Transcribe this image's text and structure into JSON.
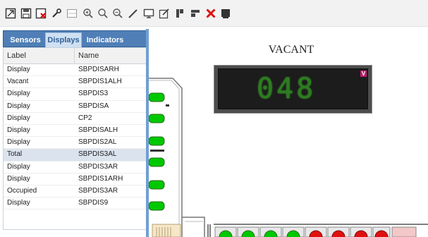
{
  "toolbar": {
    "icons": [
      "select-icon",
      "save-icon",
      "delete-file-icon",
      "wrench-icon",
      "grid-icon",
      "zoom-in-icon",
      "zoom-icon",
      "zoom-out-icon",
      "pen-icon",
      "monitor-icon",
      "edit-icon",
      "align-left-icon",
      "align-top-icon",
      "close-icon",
      "stamp-icon"
    ]
  },
  "panel": {
    "tabs": [
      {
        "label": "Sensors"
      },
      {
        "label": "Displays"
      },
      {
        "label": "Indicators"
      }
    ],
    "active_tab": "Displays",
    "columns": {
      "label": "Label",
      "name": "Name"
    },
    "rows": [
      {
        "label": "Display",
        "name": "SBPDISARH"
      },
      {
        "label": "Vacant",
        "name": "SBPDIS1ALH"
      },
      {
        "label": "Display",
        "name": "SBPDIS3"
      },
      {
        "label": "Display",
        "name": "SBPDISA"
      },
      {
        "label": "Display",
        "name": "CP2"
      },
      {
        "label": "Display",
        "name": "SBPDISALH"
      },
      {
        "label": "Display",
        "name": "SBPDIS2AL"
      },
      {
        "label": "Total",
        "name": "SBPDIS3AL"
      },
      {
        "label": "Display",
        "name": "SBPDIS3AR"
      },
      {
        "label": "Display",
        "name": "SBPDIS1ARH"
      },
      {
        "label": "Occupied",
        "name": "SBPDIS3AR"
      },
      {
        "label": "Display",
        "name": "SBPDIS9"
      }
    ],
    "selected_row": 7
  },
  "plan": {
    "title": "VACANT",
    "display_value": "048",
    "badge": "V",
    "colors": {
      "green_led": "#00c800",
      "red_led": "#e01010",
      "digit": "#2c7d1f",
      "badge": "#c2186a"
    }
  }
}
